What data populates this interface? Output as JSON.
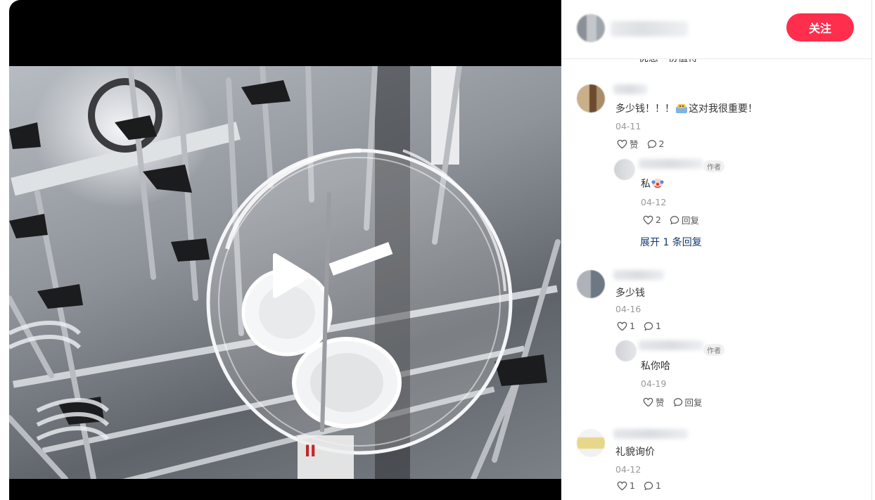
{
  "author": {
    "follow_label": "关注"
  },
  "cutoff_text": "优惠一份值得",
  "comments": [
    {
      "text_before": "多少钱！！！",
      "text_emoji": "party-emoji",
      "text_after": "这对我很重要！",
      "date": "04-11",
      "like_label": "赞",
      "reply_count": "2",
      "replies": [
        {
          "author_tag": "作者",
          "text": "私",
          "text_emoji": "clown-emoji",
          "date": "04-12",
          "like_count": "2",
          "reply_label": "回复"
        }
      ],
      "expand_label": "展开 1 条回复"
    },
    {
      "text": "多少钱",
      "date": "04-16",
      "like_count": "1",
      "reply_count": "1",
      "replies": [
        {
          "author_tag": "作者",
          "text": "私你哈",
          "date": "04-19",
          "like_label": "赞",
          "reply_label": "回复"
        }
      ]
    },
    {
      "text": "礼貌询价",
      "date": "04-12",
      "like_count": "1",
      "reply_count": "1"
    }
  ],
  "icons": {
    "like": "heart-icon",
    "reply": "comment-bubble-icon",
    "play": "play-icon"
  },
  "colors": {
    "follow_button": "#ff2e4d",
    "expand_link": "#13386c",
    "date": "#999999"
  }
}
